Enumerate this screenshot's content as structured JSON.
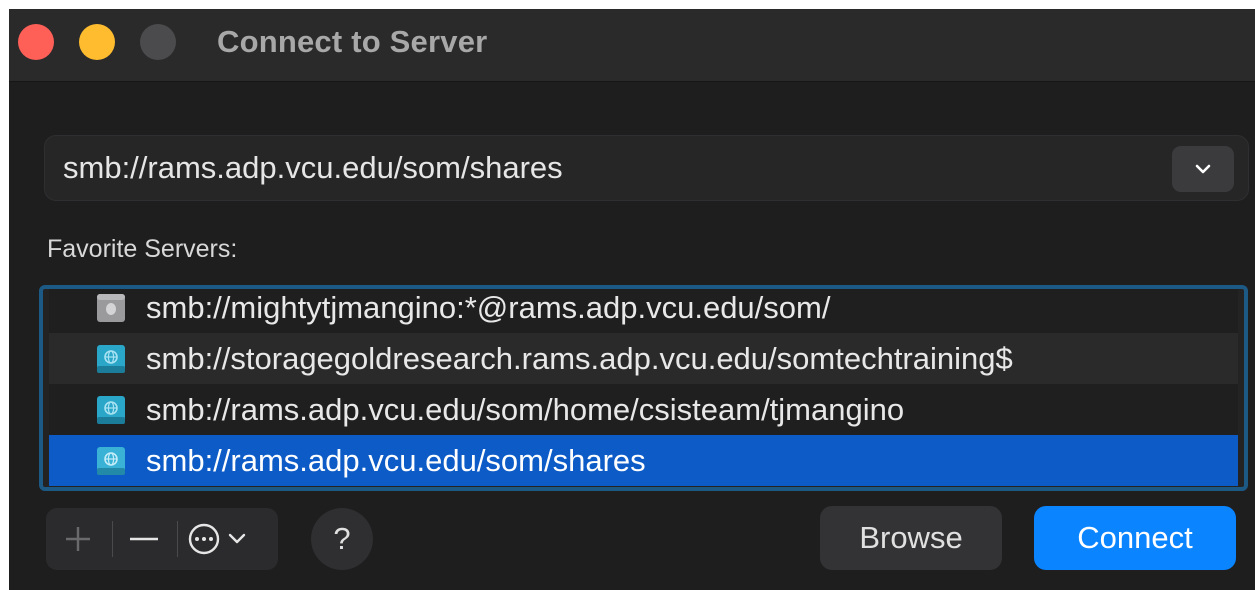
{
  "window": {
    "title": "Connect to Server"
  },
  "address": {
    "value": "smb://rams.adp.vcu.edu/som/shares"
  },
  "favorites": {
    "label": "Favorite Servers:",
    "items": [
      {
        "text": "smb://mightytjmangino:*@rams.adp.vcu.edu/som/",
        "icon": "server-gray-icon"
      },
      {
        "text": "smb://storagegoldresearch.rams.adp.vcu.edu/somtechtraining$",
        "icon": "network-globe-icon"
      },
      {
        "text": "smb://rams.adp.vcu.edu/som/home/csisteam/tjmangino",
        "icon": "network-globe-icon"
      },
      {
        "text": "smb://rams.adp.vcu.edu/som/shares",
        "icon": "network-globe-icon",
        "selected": true
      }
    ]
  },
  "toolbar": {
    "help": "?",
    "browse": "Browse",
    "connect": "Connect"
  },
  "colors": {
    "accent": "#0a84ff",
    "selection": "#0d5bc7",
    "focus_ring": "#1c5a85",
    "close": "#fe5f57",
    "minimize": "#febc2e"
  }
}
